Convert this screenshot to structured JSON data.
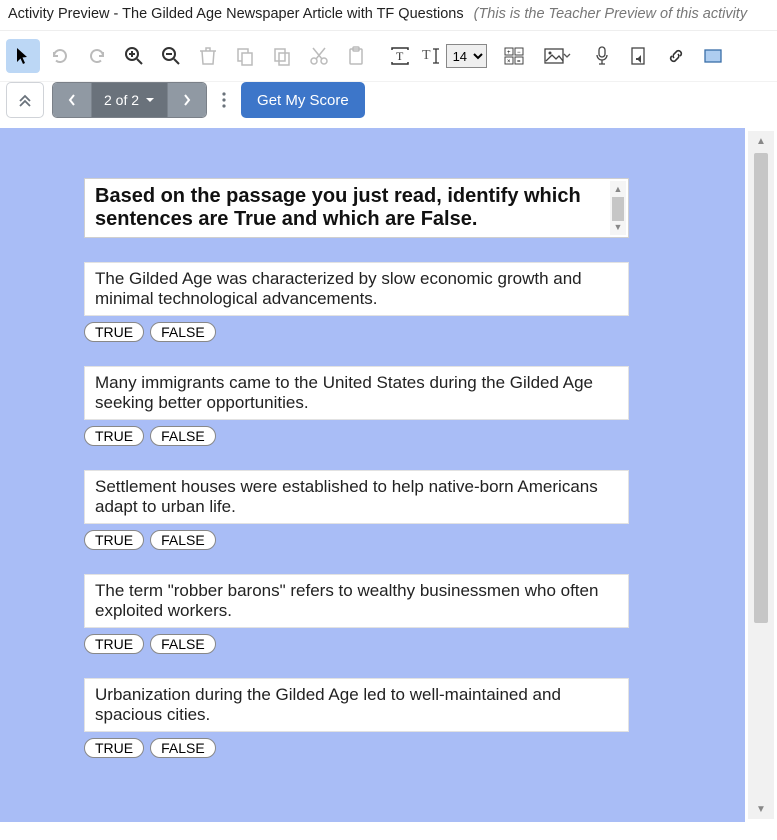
{
  "header": {
    "title": "Activity Preview - The Gilded Age Newspaper Article with TF Questions",
    "subtitle": "(This is the Teacher Preview of this activity"
  },
  "toolbar": {
    "font_size": "14"
  },
  "pager": {
    "label": "2 of 2",
    "score_label": "Get My Score"
  },
  "instructions": "Based on the passage you just read, identify which sentences are True and which are False.",
  "tf_labels": {
    "true": "TRUE",
    "false": "FALSE"
  },
  "questions": [
    "The Gilded Age was characterized by slow economic growth and minimal technological advancements.",
    "Many immigrants came to the United States during the Gilded Age seeking better opportunities.",
    "Settlement houses were established to help native-born Americans adapt to urban life.",
    "The term \"robber barons\" refers to wealthy businessmen who often exploited workers.",
    "Urbanization during the Gilded Age led to well-maintained and spacious cities."
  ]
}
